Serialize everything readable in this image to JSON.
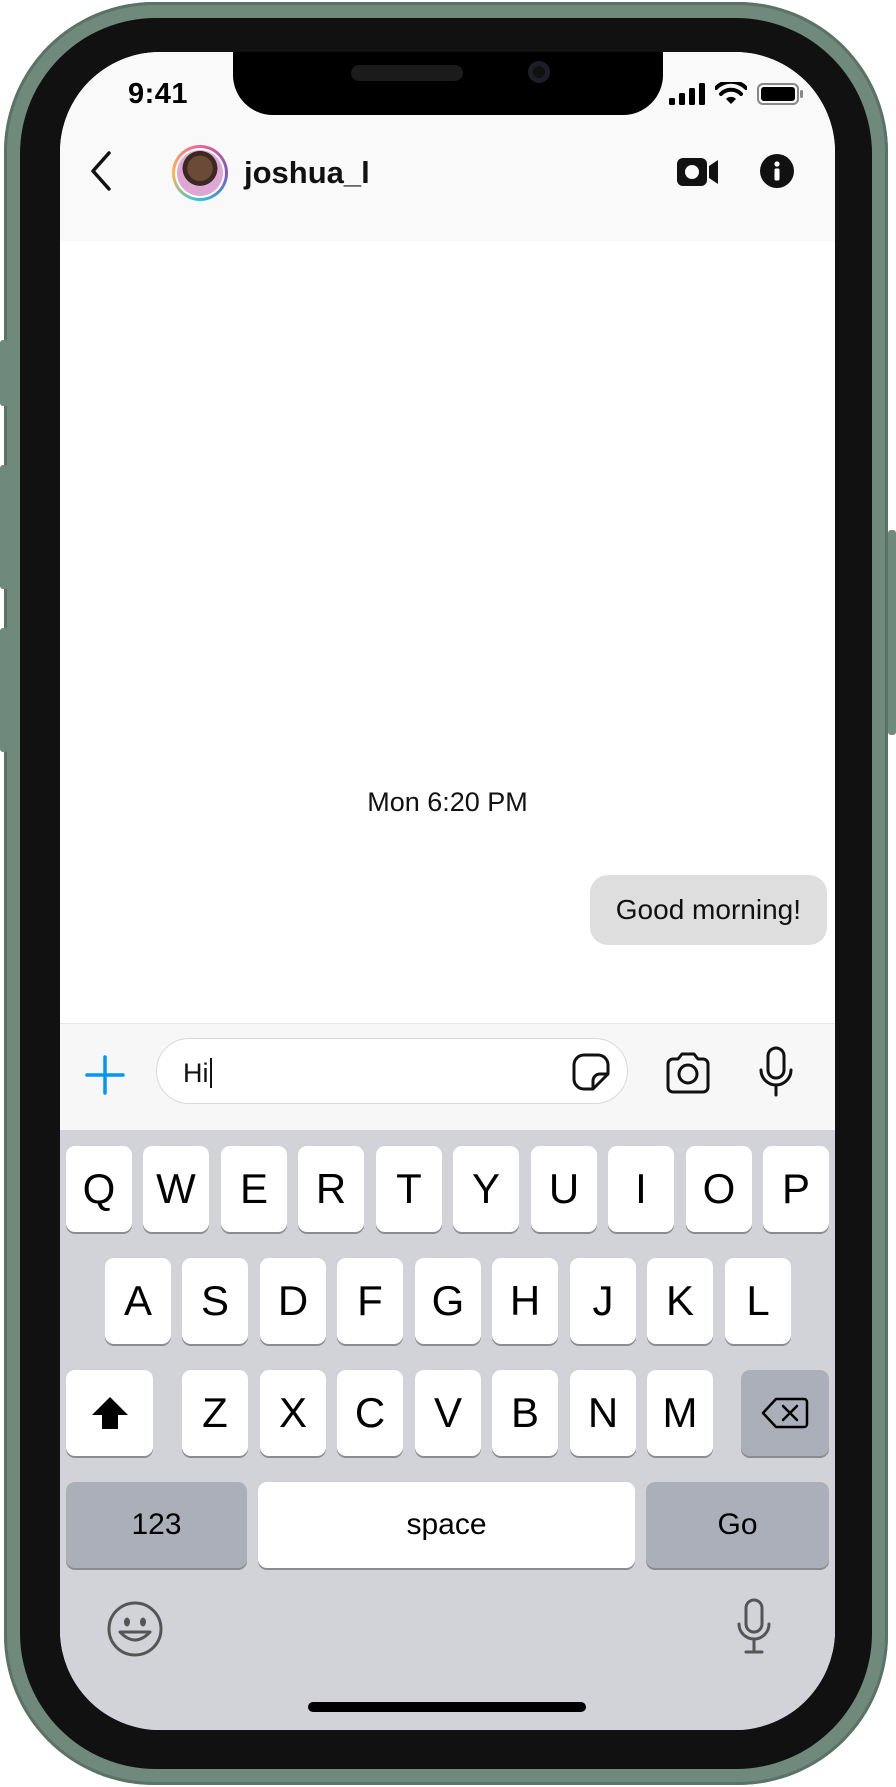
{
  "status_bar": {
    "time": "9:41"
  },
  "header": {
    "username": "joshua_l"
  },
  "messages": {
    "timestamp": "Mon 6:20 PM",
    "items": [
      {
        "text": "Good morning!",
        "sender": "me"
      }
    ]
  },
  "composer": {
    "input_value": "Hi"
  },
  "keyboard": {
    "row1": [
      "Q",
      "W",
      "E",
      "R",
      "T",
      "Y",
      "U",
      "I",
      "O",
      "P"
    ],
    "row2": [
      "A",
      "S",
      "D",
      "F",
      "G",
      "H",
      "J",
      "K",
      "L"
    ],
    "row3": [
      "Z",
      "X",
      "C",
      "V",
      "B",
      "N",
      "M"
    ],
    "numbers_label": "123",
    "space_label": "space",
    "go_label": "Go"
  },
  "colors": {
    "accent": "#0095f6",
    "bubble": "#dedede",
    "keyboard_bg": "#d1d3d9",
    "frame": "#6f8a7c"
  }
}
